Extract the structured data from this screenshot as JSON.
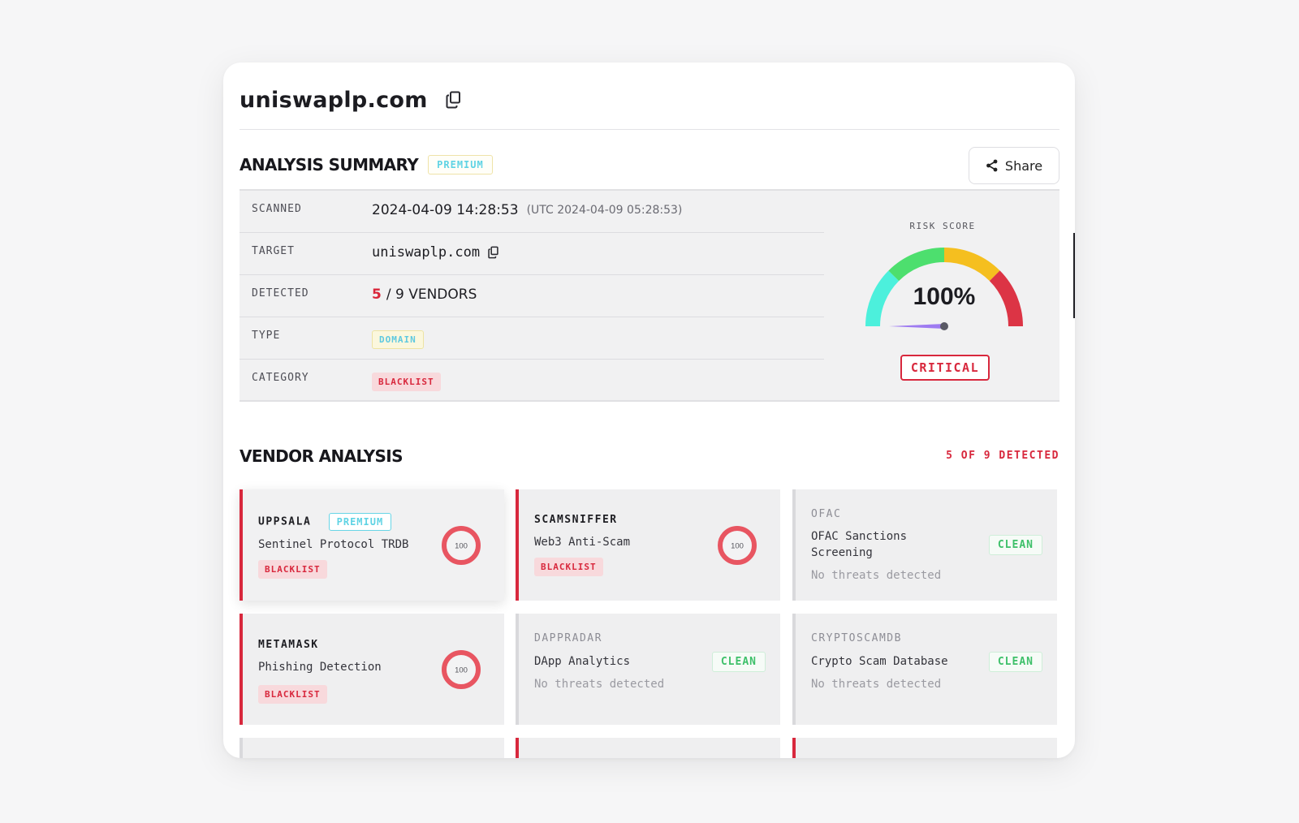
{
  "header": {
    "domain": "uniswaplp.com"
  },
  "summary": {
    "title": "ANALYSIS SUMMARY",
    "badge": "PREMIUM",
    "share_label": "Share",
    "rows": {
      "scanned": {
        "label": "SCANNED",
        "value": "2024-04-09 14:28:53",
        "utc": "(UTC 2024-04-09 05:28:53)"
      },
      "target": {
        "label": "TARGET",
        "value": "uniswaplp.com"
      },
      "detected": {
        "label": "DETECTED",
        "count": "5",
        "rest": "/ 9 VENDORS"
      },
      "type": {
        "label": "TYPE",
        "value": "DOMAIN"
      },
      "category": {
        "label": "CATEGORY",
        "value": "BLACKLIST"
      }
    },
    "risk": {
      "label": "RISK SCORE",
      "value": "100%",
      "level": "CRITICAL",
      "score": 100
    }
  },
  "vendors": {
    "title": "VENDOR ANALYSIS",
    "count_label": "5 OF 9 DETECTED",
    "cards": [
      {
        "name": "UPPSALA",
        "premium": "PREMIUM",
        "desc": "Sentinel Protocol TRDB",
        "tag": "BLACKLIST",
        "score": "100"
      },
      {
        "name": "SCAMSNIFFER",
        "desc": "Web3 Anti-Scam",
        "tag": "BLACKLIST",
        "score": "100"
      },
      {
        "name": "OFAC",
        "desc_line1": "OFAC Sanctions",
        "desc_line2": "Screening",
        "note": "No threats detected",
        "status": "CLEAN"
      },
      {
        "name": "METAMASK",
        "desc": "Phishing Detection",
        "tag": "BLACKLIST",
        "score": "100"
      },
      {
        "name": "DAPPRADAR",
        "desc": "DApp Analytics",
        "note": "No threats detected",
        "status": "CLEAN"
      },
      {
        "name": "CRYPTOSCAMDB",
        "desc": "Crypto Scam Database",
        "note": "No threats detected",
        "status": "CLEAN"
      }
    ]
  },
  "colors": {
    "danger": "#d8283d",
    "clean": "#3ec06a",
    "premium": "#5fd3e4",
    "gauge_cyan": "#4cf0dc",
    "gauge_green": "#4ddf6e",
    "gauge_yellow": "#f5bf1f",
    "gauge_red": "#dc3445"
  }
}
